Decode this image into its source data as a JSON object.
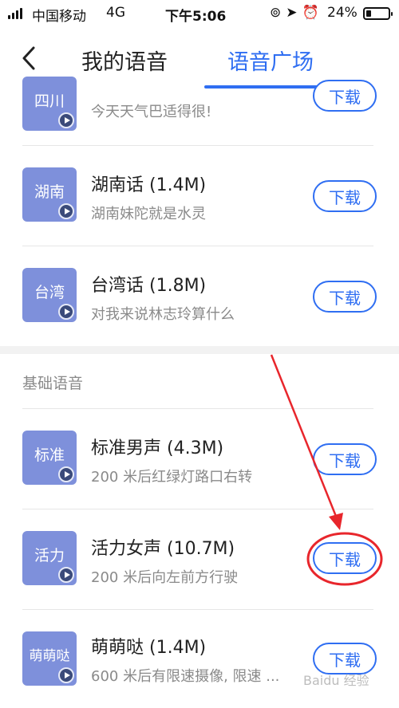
{
  "status_bar": {
    "carrier": "中国移动",
    "network": "4G",
    "time": "下午5:06",
    "battery_percent": "24%",
    "battery_level": 0.24
  },
  "nav": {
    "tab_mine": "我的语音",
    "tab_square": "语音广场",
    "active_tab": "语音广场"
  },
  "partial_item": {
    "thumb": "四川",
    "desc": "今天天气巴适得很!",
    "button": "下载"
  },
  "dialect_items": [
    {
      "thumb": "湖南",
      "name": "湖南话 (1.4M)",
      "desc": "湖南妹陀就是水灵",
      "button": "下载"
    },
    {
      "thumb": "台湾",
      "name": "台湾话 (1.8M)",
      "desc": "对我来说林志玲算什么",
      "button": "下载"
    }
  ],
  "section_title": "基础语音",
  "basic_items": [
    {
      "thumb": "标准",
      "name": "标准男声 (4.3M)",
      "desc": "200 米后红绿灯路口右转",
      "button": "下载"
    },
    {
      "thumb": "活力",
      "name": "活力女声 (10.7M)",
      "desc": "200 米后向左前方行驶",
      "button": "下载"
    },
    {
      "thumb": "萌萌哒",
      "name": "萌萌哒 (1.4M)",
      "desc": "600 米后有限速摄像, 限速 ...",
      "button": "下载"
    }
  ],
  "watermark": "Baidu 经验",
  "colors": {
    "accent": "#2f6ef2",
    "thumb_bg": "#7e90db",
    "annotation": "#e8262c"
  }
}
